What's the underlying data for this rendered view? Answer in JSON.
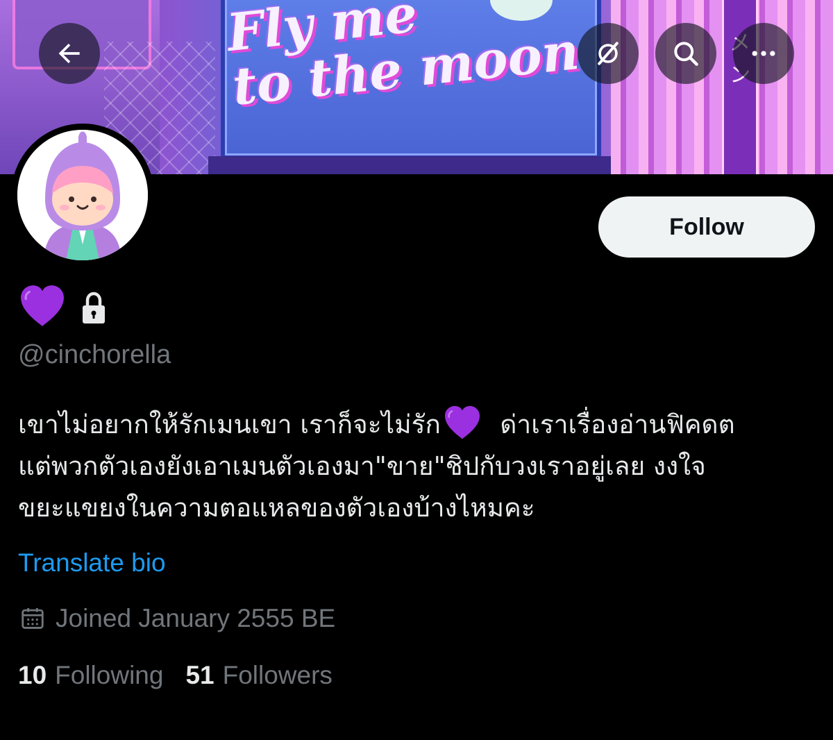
{
  "header": {
    "back_icon": "arrow-left-icon",
    "grok_icon": "grok-icon",
    "search_icon": "search-icon",
    "more_icon": "more-horizontal-icon"
  },
  "banner": {
    "sign_line1": "Fly me",
    "sign_line2": "to the moon",
    "vertical_sign": "メン"
  },
  "profile": {
    "follow_label": "Follow",
    "display_name_icon": "purple-heart-icon",
    "protected_icon": "lock-icon",
    "handle": "@cinchorella",
    "bio_lines": [
      "เขาไม่อยากให้รักเมนเขา เราก็จะไม่รัก",
      "ด่าเราเรื่องอ่านฟิคดต",
      "แต่พวกตัวเองยังเอาเมนตัวเองมา\"ขาย\"ชิปกับวงเราอยู่เลย งงใจ",
      "ขยะแขยงในความตอแหลของตัวเองบ้างไหมคะ"
    ],
    "translate_label": "Translate bio",
    "joined_icon": "calendar-icon",
    "joined_text": "Joined January 2555 BE",
    "following_count": "10",
    "following_label": "Following",
    "followers_count": "51",
    "followers_label": "Followers"
  },
  "colors": {
    "background": "#000000",
    "text_primary": "#e7e9ea",
    "text_secondary": "#71767b",
    "link": "#1d9bf0",
    "accent_heart": "#9b30e0"
  }
}
